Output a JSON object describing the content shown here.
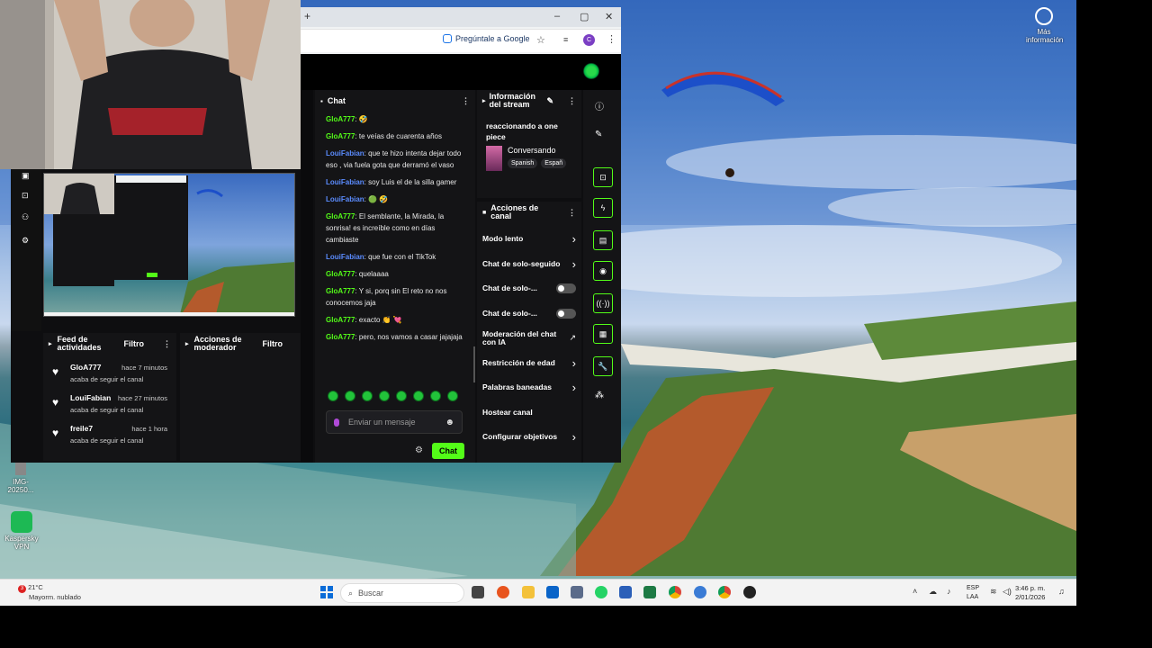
{
  "browser": {
    "new_tab": "+",
    "ask_google": "Pregúntale a Google",
    "profile_initial": "C"
  },
  "chat": {
    "title": "Chat",
    "messages": [
      {
        "user": "GloA777",
        "color": "green",
        "text": ": 🤣"
      },
      {
        "user": "GloA777",
        "color": "green",
        "text": ": te veías de cuarenta años"
      },
      {
        "user": "LouiFabian",
        "color": "blue",
        "text": ": que te hizo intenta dejar todo eso , via fuela gota que derramó el vaso"
      },
      {
        "user": "LouiFabian",
        "color": "blue",
        "text": ": soy Luis el de la silla gamer"
      },
      {
        "user": "LouiFabian",
        "color": "blue",
        "text": ": 🟢 🤣"
      },
      {
        "user": "GloA777",
        "color": "green",
        "text": ": El semblante, la Mirada, la sonrisa! es increíble como en días cambiaste"
      },
      {
        "user": "LouiFabian",
        "color": "blue",
        "text": ": que fue con el TikTok"
      },
      {
        "user": "GloA777",
        "color": "green",
        "text": ": quelaaaa"
      },
      {
        "user": "GloA777",
        "color": "green",
        "text": ": Y si, porq sin El reto no nos conocemos jaja"
      },
      {
        "user": "GloA777",
        "color": "green",
        "text": ": exacto 👏 💘"
      },
      {
        "user": "GloA777",
        "color": "green",
        "text": ": pero, nos vamos a casar jajajaja"
      }
    ],
    "input_placeholder": "Enviar un mensaje",
    "send_label": "Chat"
  },
  "stream_info": {
    "title": "Información del stream",
    "stream_title": "reaccionando a one piece",
    "category": "Conversando",
    "tags": [
      "Spanish",
      "Españ"
    ]
  },
  "channel_actions": {
    "title": "Acciones de canal",
    "items": [
      {
        "label": "Modo lento",
        "control": "chevron"
      },
      {
        "label": "Chat de solo-seguido",
        "control": "chevron"
      },
      {
        "label": "Chat de solo-...",
        "control": "toggle"
      },
      {
        "label": "Chat de solo-...",
        "control": "toggle"
      },
      {
        "label": "Moderación del chat con IA",
        "control": "external"
      },
      {
        "label": "Restricción de edad",
        "control": "chevron"
      },
      {
        "label": "Palabras baneadas",
        "control": "chevron"
      },
      {
        "label": "Hostear canal",
        "control": "none"
      },
      {
        "label": "Configurar objetivos",
        "control": "chevron"
      }
    ]
  },
  "feed": {
    "title": "Feed de actividades",
    "filter": "Filtro",
    "items": [
      {
        "name": "GloA777",
        "time": "hace 7 minutos",
        "desc": "acaba de seguir el canal"
      },
      {
        "name": "LouiFabian",
        "time": "hace 27 minutos",
        "desc": "acaba de seguir el canal"
      },
      {
        "name": "freile7",
        "time": "hace 1 hora",
        "desc": "acaba de seguir el canal"
      }
    ]
  },
  "mod_actions": {
    "title": "Acciones de moderador",
    "filter": "Filtro"
  },
  "desktop": {
    "icons": [
      {
        "label": "Más información"
      },
      {
        "label": "IMG-20250..."
      },
      {
        "label": "Kaspersky VPN"
      }
    ]
  },
  "taskbar": {
    "weather_temp": "21°C",
    "weather_desc": "Mayorm. nublado",
    "weather_badge": "3",
    "search_placeholder": "Buscar",
    "lang": "ESP",
    "lang_sub": "LAA",
    "time": "3:46 p. m.",
    "date": "2/01/2026"
  },
  "colors": {
    "accent": "#53fc18",
    "panel": "#141416",
    "user_blue": "#5b8cff"
  }
}
